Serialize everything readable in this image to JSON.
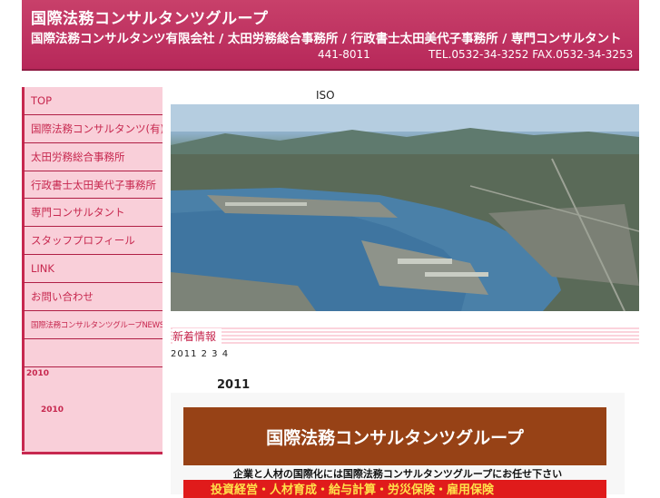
{
  "header": {
    "title": "国際法務コンサルタンツグループ",
    "subtitle": "国際法務コンサルタンツ有限会社 / 太田労務総合事務所 / 行政書士太田美代子事務所 / 専門コンサルタント",
    "postal_code": "441-8011",
    "contact": "TEL.0532-34-3252 FAX.0532-34-3253"
  },
  "sidebar": {
    "items": [
      {
        "label": "TOP"
      },
      {
        "label": "国際法務コンサルタンツ(有)"
      },
      {
        "label": "太田労務総合事務所"
      },
      {
        "label": "行政書士太田美代子事務所"
      },
      {
        "label": "専門コンサルタント"
      },
      {
        "label": "スタッフプロフィール"
      },
      {
        "label": "LINK"
      },
      {
        "label": "お問い合わせ"
      },
      {
        "label": "国際法務コンサルタンツグループNEWS"
      },
      {
        "label": ""
      }
    ],
    "archive_year": "2010",
    "archive_sub": "2010"
  },
  "main": {
    "iso_label": "ISO",
    "news_title": "新着情報",
    "news_dates": "2011 2 3 4",
    "year_heading": "2011",
    "banner": {
      "title": "国際法務コンサルタンツグループ",
      "tagline": "企業と人材の国際化には国際法務コンサルタンツグループにお任せ下さい",
      "red_text": "投資経営・人材育成・給与計算・労災保険・雇用保険"
    }
  },
  "colors": {
    "header_bg": "#c03763",
    "accent": "#c7284f",
    "sidebar_bg": "#f9cfd9",
    "banner_brown": "#974216"
  }
}
